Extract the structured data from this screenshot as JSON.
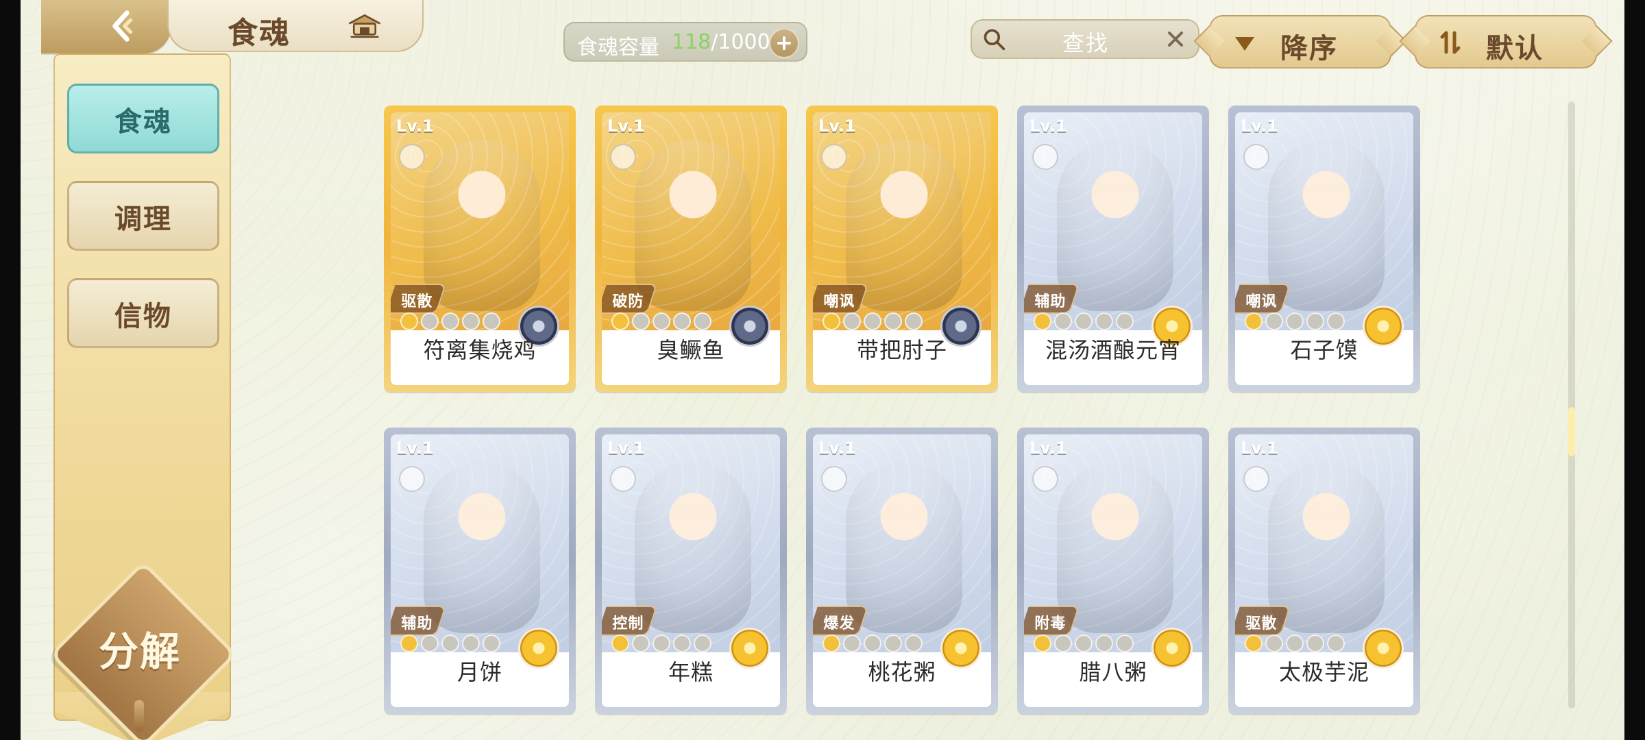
{
  "header": {
    "title": "食魂",
    "capacity_label": "食魂容量",
    "capacity_current": "118",
    "capacity_max": "/1000",
    "search_placeholder": "查找",
    "sort_order_label": "降序",
    "sort_mode_label": "默认"
  },
  "sidebar": {
    "tabs": [
      {
        "label": "食魂",
        "active": true
      },
      {
        "label": "调理",
        "active": false
      },
      {
        "label": "信物",
        "active": false
      }
    ],
    "decompose_label": "分解"
  },
  "cards": [
    {
      "level": "Lv.1",
      "role": "驱散",
      "name": "符离集烧鸡",
      "frame": "gold",
      "badge": "navy",
      "stars": 1
    },
    {
      "level": "Lv.1",
      "role": "破防",
      "name": "臭鳜鱼",
      "frame": "gold",
      "badge": "navy",
      "stars": 1
    },
    {
      "level": "Lv.1",
      "role": "嘲讽",
      "name": "带把肘子",
      "frame": "gold",
      "badge": "navy",
      "stars": 1
    },
    {
      "level": "Lv.1",
      "role": "辅助",
      "name": "混汤酒酿元宵",
      "frame": "silver",
      "badge": "flower",
      "stars": 1
    },
    {
      "level": "Lv.1",
      "role": "嘲讽",
      "name": "石子馍",
      "frame": "silver",
      "badge": "flower",
      "stars": 1
    },
    {
      "level": "Lv.1",
      "role": "辅助",
      "name": "月饼",
      "frame": "silver",
      "badge": "flower",
      "stars": 1
    },
    {
      "level": "Lv.1",
      "role": "控制",
      "name": "年糕",
      "frame": "silver",
      "badge": "flower",
      "stars": 1
    },
    {
      "level": "Lv.1",
      "role": "爆发",
      "name": "桃花粥",
      "frame": "silver",
      "badge": "flower",
      "stars": 1
    },
    {
      "level": "Lv.1",
      "role": "附毒",
      "name": "腊八粥",
      "frame": "silver",
      "badge": "flower",
      "stars": 1
    },
    {
      "level": "Lv.1",
      "role": "驱散",
      "name": "太极芋泥",
      "frame": "silver",
      "badge": "flower",
      "stars": 1
    }
  ],
  "icons": {
    "back": "back-arrow-icon",
    "home": "home-pavilion-icon",
    "search": "search-icon",
    "clear": "close-icon",
    "sort_desc": "sort-desc-icon",
    "sort_mode": "sort-mode-icon",
    "plus": "plus-icon"
  }
}
